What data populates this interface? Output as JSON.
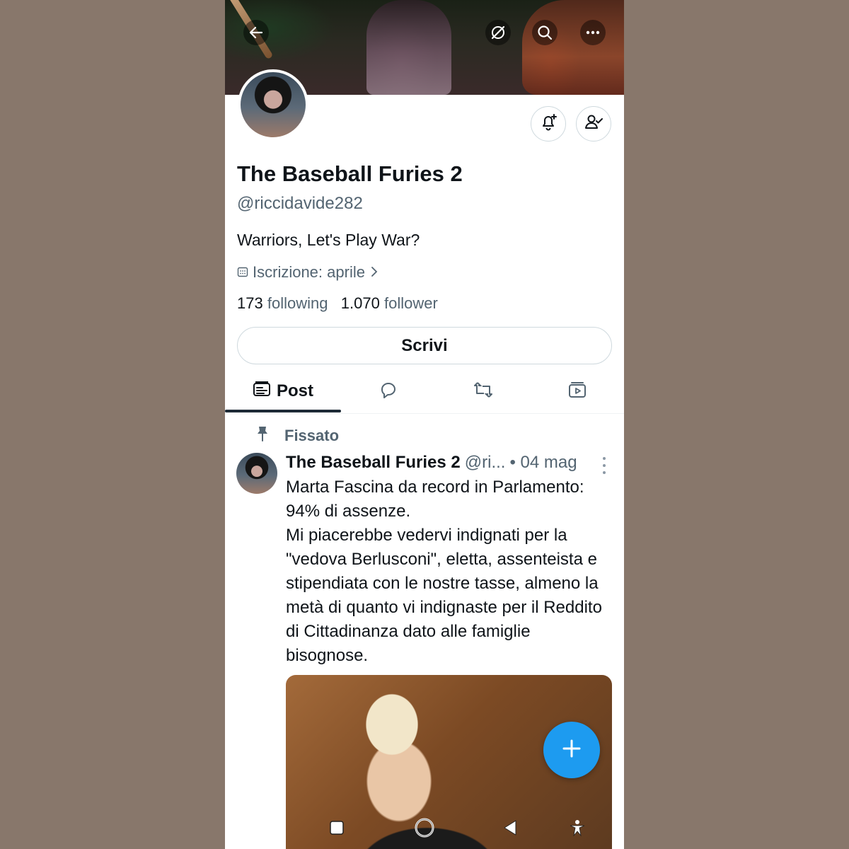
{
  "header": {
    "icons": [
      "back-arrow-icon",
      "grok-icon",
      "search-icon",
      "more-icon"
    ]
  },
  "profile": {
    "display_name": "The Baseball Furies 2",
    "handle": "@riccidavide282",
    "bio": "Warriors, Let's Play War?",
    "joined": "Iscrizione: aprile",
    "following_count": "173",
    "following_label": "following",
    "followers_count": "1.070",
    "followers_label": "follower",
    "write_label": "Scrivi"
  },
  "tabs": [
    {
      "label": "Post",
      "icon": "post-icon",
      "active": true
    },
    {
      "label": "",
      "icon": "reply-icon",
      "active": false
    },
    {
      "label": "",
      "icon": "retweet-icon",
      "active": false
    },
    {
      "label": "",
      "icon": "media-icon",
      "active": false
    }
  ],
  "tweet": {
    "pinned_label": "Fissato",
    "author": "The Baseball Furies 2",
    "handle": "@ri...",
    "date": "• 04 mag",
    "text": "Marta Fascina da record in Parlamento: 94% di assenze.\nMi piacerebbe vedervi indignati per la \"vedova Berlusconi\", eletta, assenteista e stipendiata con le nostre tasse, almeno la metà di quanto vi indignaste per il Reddito di Cittadinanza dato alle famiglie bisognose."
  },
  "colors": {
    "accent": "#1d9bf0",
    "text_primary": "#0f1419",
    "text_secondary": "#536471",
    "background_outer": "#88776b"
  }
}
